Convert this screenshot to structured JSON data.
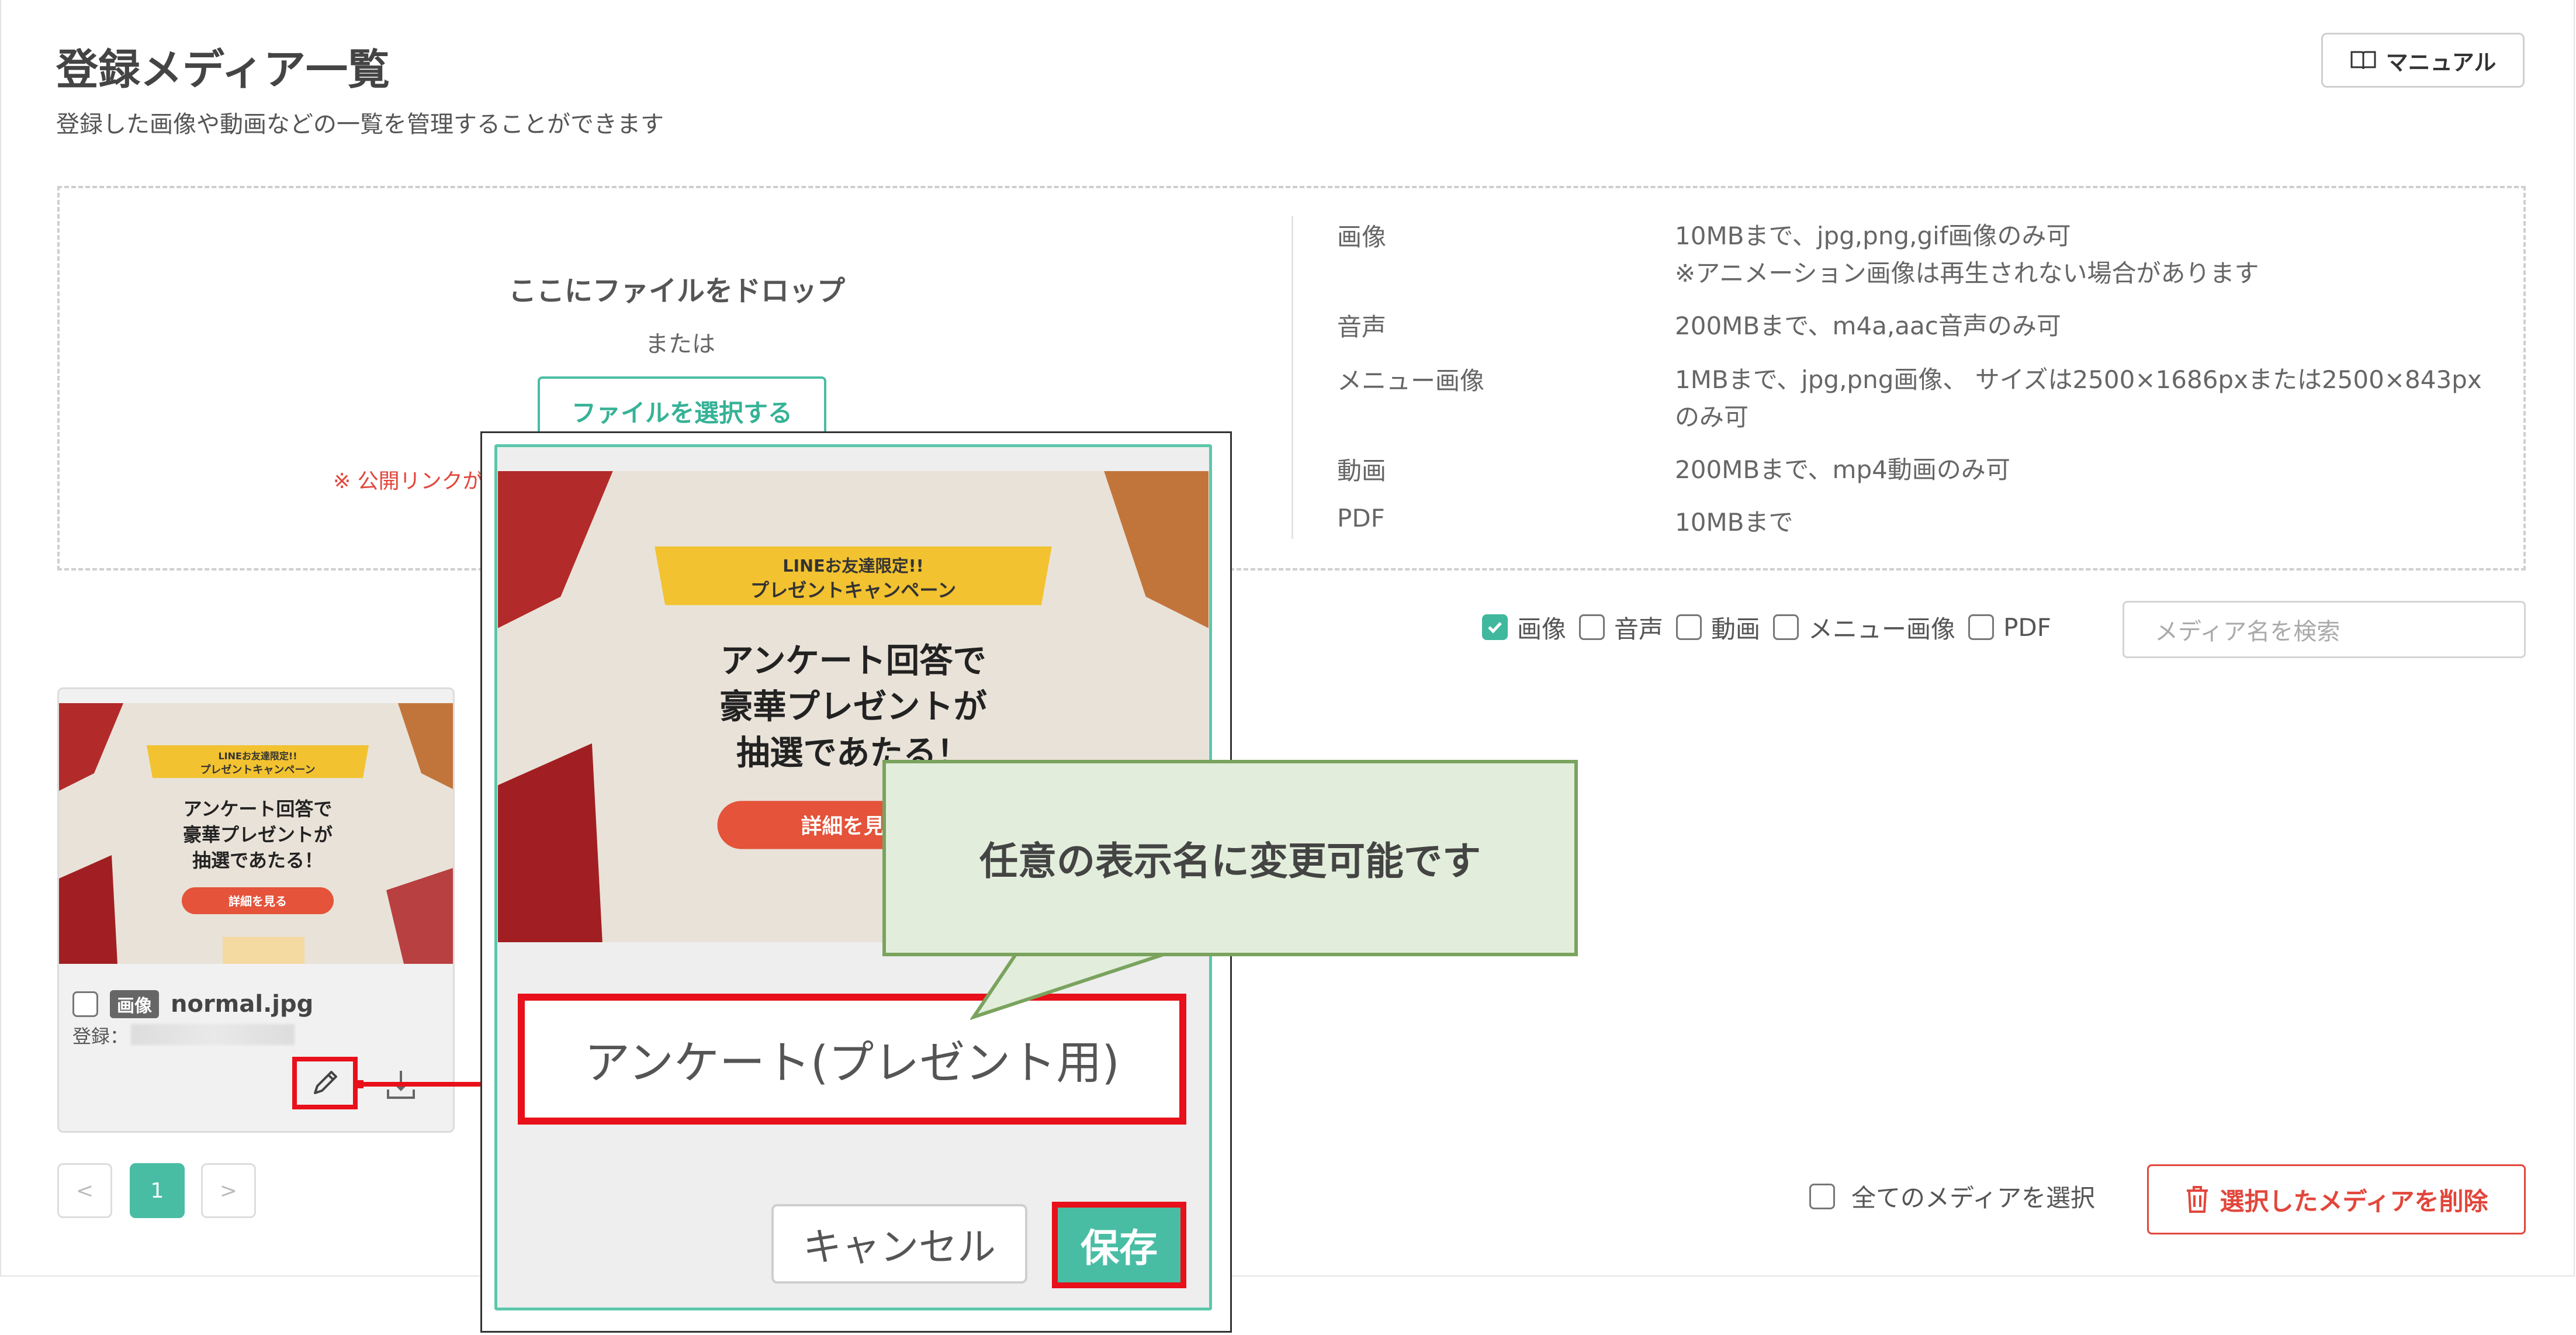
{
  "header": {
    "title": "登録メディア一覧",
    "subtitle": "登録した画像や動画などの一覧を管理することができます",
    "manual_label": "マニュアル"
  },
  "dropzone": {
    "title": "ここにファイルをドロップ",
    "or_text": "または",
    "select_button": "ファイルを選択する",
    "notice": "※ 公開リンクが"
  },
  "specs": [
    {
      "label": "画像",
      "lines": [
        "10MBまで、jpg,png,gif画像のみ可",
        "※アニメーション画像は再生されない場合があります"
      ]
    },
    {
      "label": "音声",
      "lines": [
        "200MBまで、m4a,aac音声のみ可"
      ]
    },
    {
      "label": "メニュー画像",
      "lines": [
        "1MBまで、jpg,png画像、 サイズは2500×1686pxまたは2500×843px",
        "のみ可"
      ]
    },
    {
      "label": "動画",
      "lines": [
        "200MBまで、mp4動画のみ可"
      ]
    },
    {
      "label": "PDF",
      "lines": [
        "10MBまで"
      ]
    }
  ],
  "filters": {
    "items": [
      {
        "label": "画像",
        "checked": true
      },
      {
        "label": "音声",
        "checked": false
      },
      {
        "label": "動画",
        "checked": false
      },
      {
        "label": "メニュー画像",
        "checked": false
      },
      {
        "label": "PDF",
        "checked": false
      }
    ],
    "search_placeholder": "メディア名を検索"
  },
  "media_card": {
    "type_badge": "画像",
    "file_name": "normal.jpg",
    "registered_label": "登録：",
    "thumbnail": {
      "banner_top": "LINEお友達限定!!",
      "banner_bottom": "プレゼントキャンペーン",
      "headline": [
        "アンケート回答で",
        "豪華プレゼントが",
        "抽選であたる！"
      ],
      "button": "詳細を見る"
    }
  },
  "pagination": {
    "prev": "<",
    "current": "1",
    "next": ">"
  },
  "bulk": {
    "select_all_label": "全てのメディアを選択",
    "delete_label": "選択したメディアを削除"
  },
  "zoom": {
    "display_name": "アンケート(プレゼント用)",
    "cancel_label": "キャンセル",
    "save_label": "保存",
    "callout_text": "任意の表示名に変更可能です"
  },
  "colors": {
    "accent": "#49bda4",
    "highlight": "#e8101a",
    "danger": "#e2463b",
    "callout_bg": "#e2eedb",
    "callout_border": "#7aa35e"
  }
}
